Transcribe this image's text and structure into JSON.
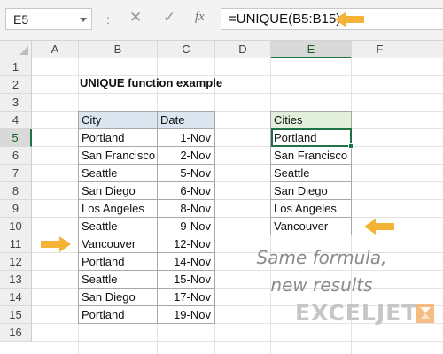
{
  "formula_bar": {
    "name_box": "E5",
    "separator": ":",
    "cancel_glyph": "✕",
    "enter_glyph": "✓",
    "fx_label": "fx",
    "formula": "=UNIQUE(B5:B15)"
  },
  "columns": [
    "A",
    "B",
    "C",
    "D",
    "E",
    "F"
  ],
  "rows": [
    "1",
    "2",
    "3",
    "4",
    "5",
    "6",
    "7",
    "8",
    "9",
    "10",
    "11",
    "12",
    "13",
    "14",
    "15",
    "16"
  ],
  "sheet": {
    "title": "UNIQUE function example",
    "source_table": {
      "headers": [
        "City",
        "Date"
      ],
      "rows": [
        [
          "Portland",
          "1-Nov"
        ],
        [
          "San Francisco",
          "2-Nov"
        ],
        [
          "Seattle",
          "5-Nov"
        ],
        [
          "San Diego",
          "6-Nov"
        ],
        [
          "Los Angeles",
          "8-Nov"
        ],
        [
          "Seattle",
          "9-Nov"
        ],
        [
          "Vancouver",
          "12-Nov"
        ],
        [
          "Portland",
          "14-Nov"
        ],
        [
          "Seattle",
          "15-Nov"
        ],
        [
          "San Diego",
          "17-Nov"
        ],
        [
          "Portland",
          "19-Nov"
        ]
      ]
    },
    "result_table": {
      "header": "Cities",
      "rows": [
        "Portland",
        "San Francisco",
        "Seattle",
        "San Diego",
        "Los Angeles",
        "Vancouver"
      ]
    }
  },
  "annotation": {
    "line1": "Same formula,",
    "line2": "new results"
  },
  "logo": {
    "text": "EXCELJET"
  },
  "colors": {
    "accent_arrow": "#f5b335",
    "excel_green": "#217346",
    "header_blue": "#dce6f1",
    "header_green": "#e2efda"
  }
}
